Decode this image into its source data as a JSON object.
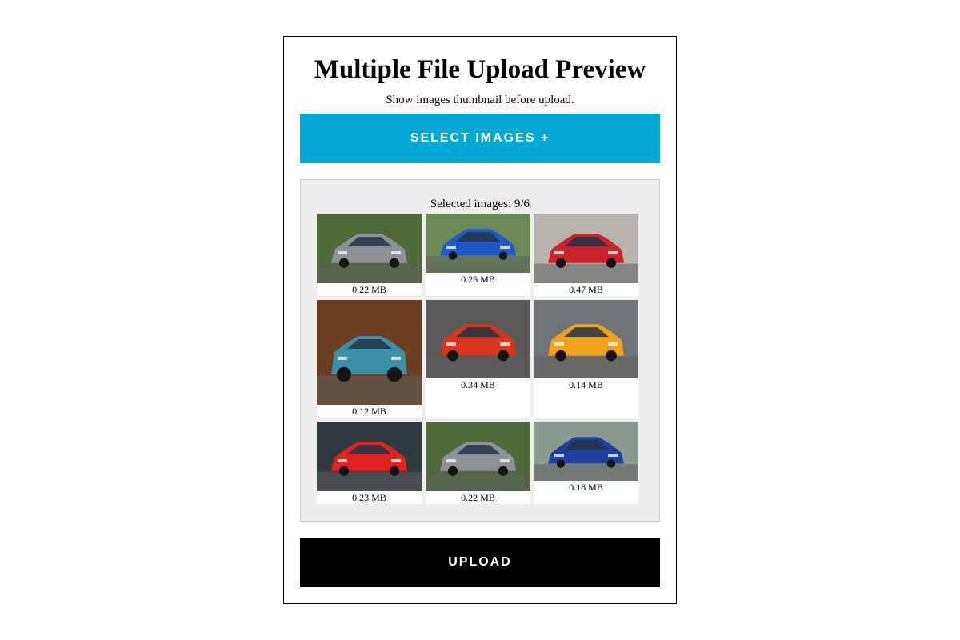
{
  "page": {
    "title": "Multiple File Upload Preview",
    "subtitle": "Show images thumbnail before upload."
  },
  "select_button": {
    "label": "SELECT IMAGES +",
    "color": "#00a8d6"
  },
  "preview": {
    "count_label": "Selected images: 9/6",
    "images": [
      {
        "size": "0.22 MB",
        "subject": "silver sports car",
        "car_color": "#8e9296",
        "bg_color": "#4f6b3a"
      },
      {
        "size": "0.26 MB",
        "subject": "blue sedan",
        "car_color": "#1f58c9",
        "bg_color": "#6b8a55"
      },
      {
        "size": "0.47 MB",
        "subject": "red classic car",
        "car_color": "#c8242a",
        "bg_color": "#b9b3ad"
      },
      {
        "size": "0.12 MB",
        "subject": "teal vintage coupe",
        "car_color": "#3d8fa6",
        "bg_color": "#6b3e22"
      },
      {
        "size": "0.34 MB",
        "subject": "red supercar",
        "car_color": "#d8351f",
        "bg_color": "#5b5a58"
      },
      {
        "size": "0.14 MB",
        "subject": "orange supercar",
        "car_color": "#f1a21b",
        "bg_color": "#6f7478"
      },
      {
        "size": "0.23 MB",
        "subject": "red roadster",
        "car_color": "#e2221e",
        "bg_color": "#2f3940"
      },
      {
        "size": "0.22 MB",
        "subject": "silver sports car",
        "car_color": "#8e9296",
        "bg_color": "#4f6b3a"
      },
      {
        "size": "0.18 MB",
        "subject": "blue coupe",
        "car_color": "#1d3f9e",
        "bg_color": "#8a9a8e"
      }
    ]
  },
  "upload_button": {
    "label": "UPLOAD",
    "color": "#000000"
  }
}
